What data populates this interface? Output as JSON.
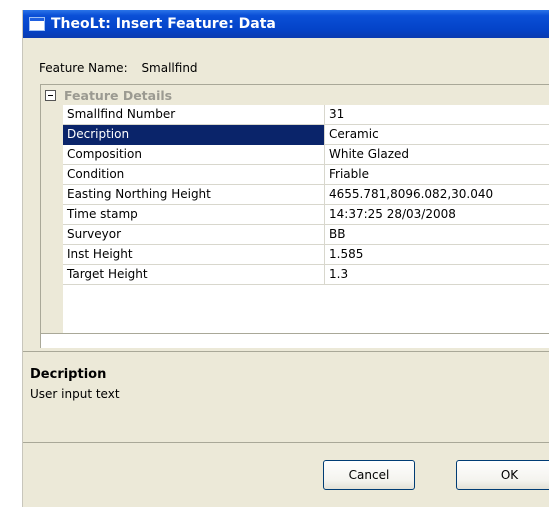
{
  "window": {
    "title": "TheoLt: Insert Feature: Data"
  },
  "feature": {
    "label": "Feature Name:",
    "value": "Smallfind"
  },
  "grid": {
    "group_title": "Feature Details",
    "rows": [
      {
        "label": "Smallfind Number",
        "value": "31"
      },
      {
        "label": "Decription",
        "value": "Ceramic",
        "selected": true,
        "has_dropdown": true
      },
      {
        "label": "Composition",
        "value": "White Glazed"
      },
      {
        "label": "Condition",
        "value": "Friable"
      },
      {
        "label": "Easting Northing Height",
        "value": "4655.781,8096.082,30.040"
      },
      {
        "label": "Time stamp",
        "value": "14:37:25 28/03/2008"
      },
      {
        "label": "Surveyor",
        "value": "BB"
      },
      {
        "label": "Inst Height",
        "value": "1.585"
      },
      {
        "label": "Target Height",
        "value": "1.3"
      }
    ]
  },
  "help": {
    "title": "Decription",
    "text": "User input text"
  },
  "buttons": {
    "cancel": "Cancel",
    "ok": "OK"
  },
  "colors": {
    "titlebar": "#0443c8",
    "selection": "#0a246a",
    "dialog_bg": "#ece9d8"
  }
}
